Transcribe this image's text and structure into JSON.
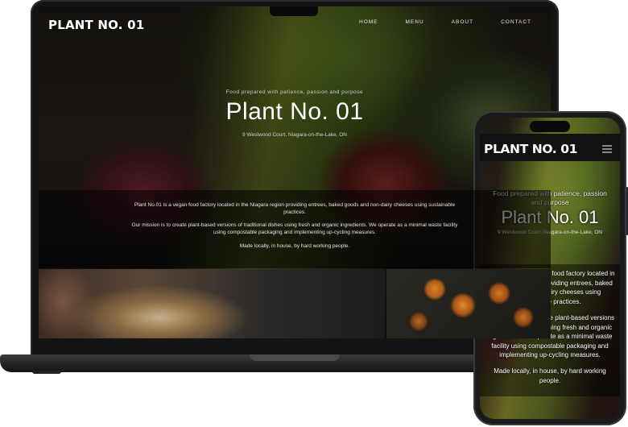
{
  "site": {
    "logo": "PLANT NO. 01",
    "nav": [
      "HOME",
      "MENU",
      "ABOUT",
      "CONTACT"
    ],
    "tagline": "Food prepared with patience, passion and purpose",
    "title": "Plant No. 01",
    "address": "9 Westwood Court, Niagara-on-the-Lake, ON",
    "paragraphs": [
      "Plant No.01 is a vegan food factory located in the Niagara region providing entrees, baked goods and non-dairy cheeses using sustainable practices.",
      "Our mission is to create plant-based versions of traditional dishes using fresh and organic ingredients. We operate as a minimal waste facility using compostable packaging and implementing up-cycling measures.",
      "Made locally, in house, by hard working people."
    ]
  },
  "icons": {
    "menu": "hamburger-menu-icon"
  },
  "colors": {
    "background": "#ffffff",
    "device_frame": "#141414",
    "text": "#ffffff"
  }
}
